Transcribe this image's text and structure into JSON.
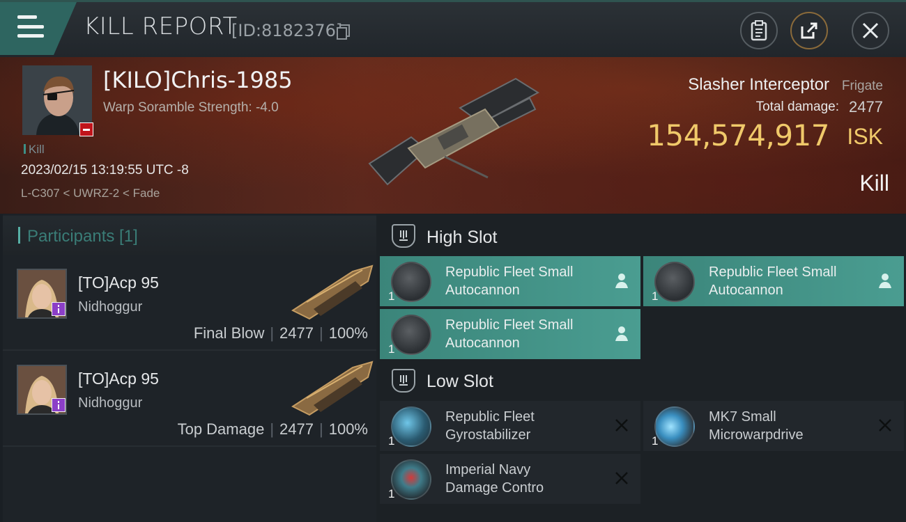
{
  "header": {
    "title": "KILL REPORT",
    "report_id": "[ID:8182376]",
    "buttons": [
      "menu-icon",
      "clipboard-icon",
      "share-icon",
      "close-icon"
    ]
  },
  "victim": {
    "pilot": "[KILO]Chris-1985",
    "warp_scramble": "Warp Soramble Strength: -4.0",
    "tag": "Kill",
    "datetime": "2023/02/15 13:19:55 UTC -8",
    "location": "L-C307 < UWRZ-2 < Fade",
    "ship_name": "Slasher Interceptor",
    "ship_class": "Frigate",
    "total_damage_label": "Total damage:",
    "total_damage": "2477",
    "isk_value": "154,574,917",
    "isk_label": "ISK",
    "result": "Kill"
  },
  "participants": {
    "title": "Participants [1]",
    "rows": [
      {
        "name": "[TO]Acp 95",
        "ship": "Nidhoggur",
        "role": "Final Blow",
        "damage": "2477",
        "percent": "100%"
      },
      {
        "name": "[TO]Acp 95",
        "ship": "Nidhoggur",
        "role": "Top Damage",
        "damage": "2477",
        "percent": "100%"
      }
    ]
  },
  "fitting": {
    "high_slot": {
      "title": "High Slot",
      "modules": [
        {
          "line1": "Republic Fleet Small",
          "line2": "Autocannon",
          "qty": "1",
          "status": "person-icon"
        },
        {
          "line1": "Republic Fleet Small",
          "line2": "Autocannon",
          "qty": "1",
          "status": "person-icon"
        },
        {
          "line1": "Republic Fleet Small",
          "line2": "Autocannon",
          "qty": "1",
          "status": "person-icon"
        }
      ]
    },
    "low_slot": {
      "title": "Low Slot",
      "modules": [
        {
          "line1": "Republic Fleet",
          "line2": "Gyrostabilizer",
          "qty": "1",
          "status": "x-icon"
        },
        {
          "line1": "MK7 Small",
          "line2": "Microwarpdrive",
          "qty": "1",
          "status": "x-icon"
        },
        {
          "line1": "Imperial Navy",
          "line2": "Damage Contro",
          "qty": "1",
          "status": "x-icon"
        }
      ]
    }
  },
  "colors": {
    "accent_teal": "#3b857a",
    "isk_gold": "#f0c96a",
    "lossy_red": "#c0141a"
  }
}
